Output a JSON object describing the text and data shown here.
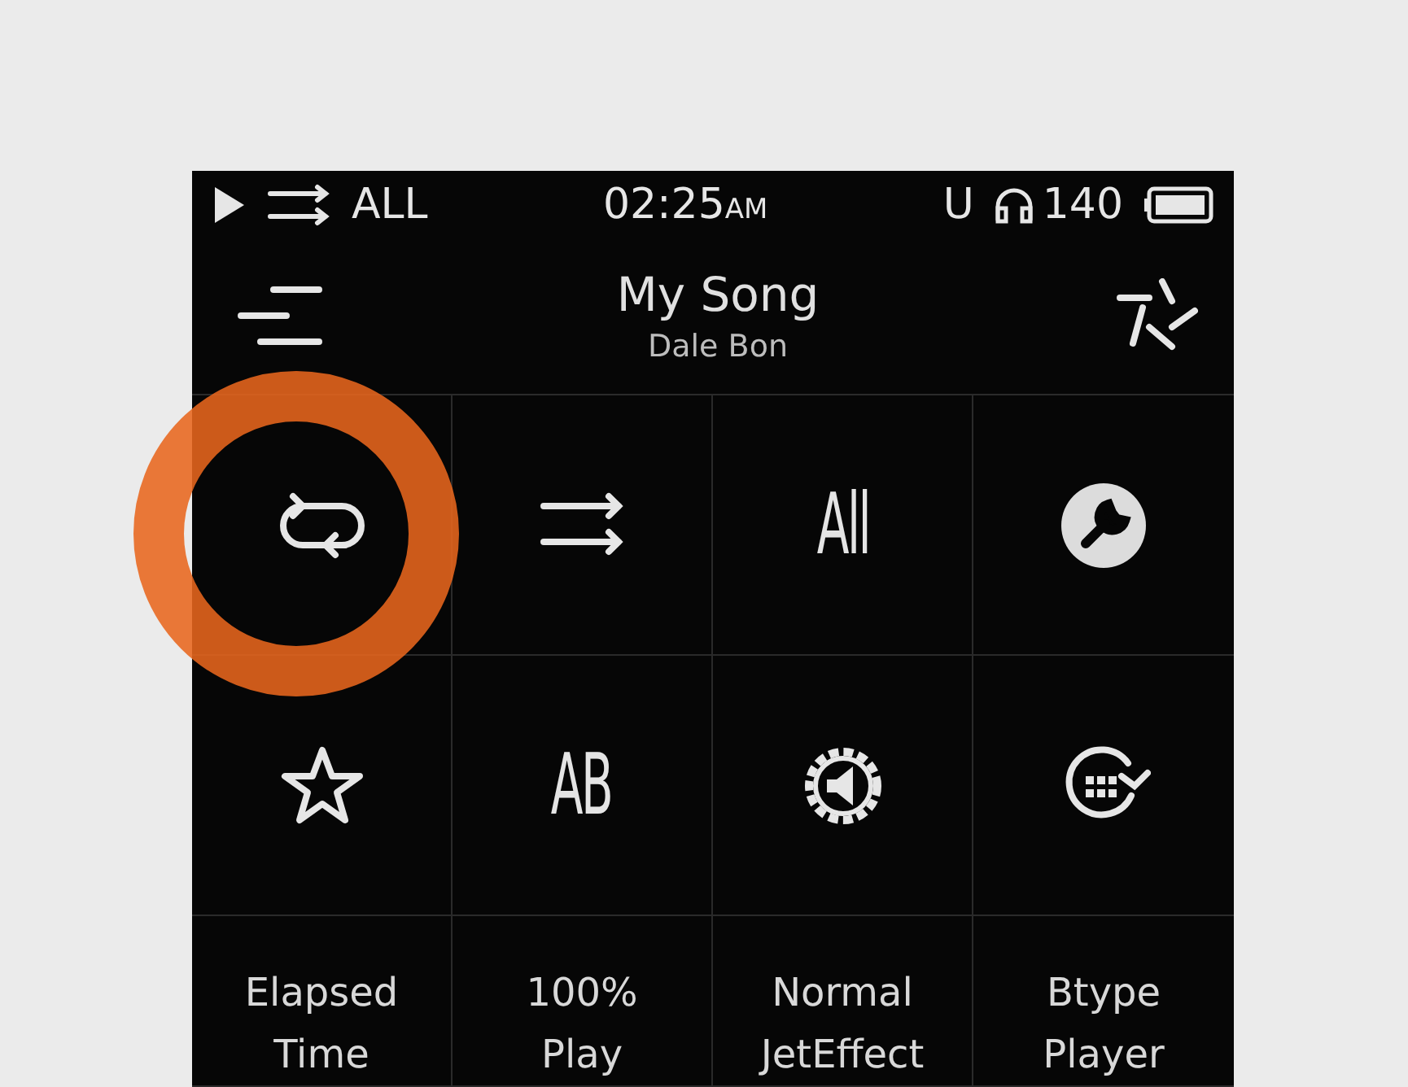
{
  "status_bar": {
    "mode": "ALL",
    "time": "02:25",
    "meridiem": "AM",
    "storage": "U",
    "volume": "140"
  },
  "now_playing": {
    "title": "My Song",
    "artist": "Dale Bon"
  },
  "tiles": [
    {
      "kind": "icon"
    },
    {
      "kind": "icon"
    },
    {
      "kind": "glyph",
      "text": "All"
    },
    {
      "kind": "icon"
    },
    {
      "kind": "icon"
    },
    {
      "kind": "glyph",
      "text": "AB"
    },
    {
      "kind": "icon"
    },
    {
      "kind": "icon"
    },
    {
      "kind": "label",
      "lines": [
        "Elapsed",
        "Time"
      ]
    },
    {
      "kind": "label",
      "lines": [
        "100%",
        "Play"
      ]
    },
    {
      "kind": "label",
      "lines": [
        "Normal",
        "JetEffect"
      ]
    },
    {
      "kind": "label",
      "lines": [
        "Btype",
        "Player"
      ]
    }
  ]
}
